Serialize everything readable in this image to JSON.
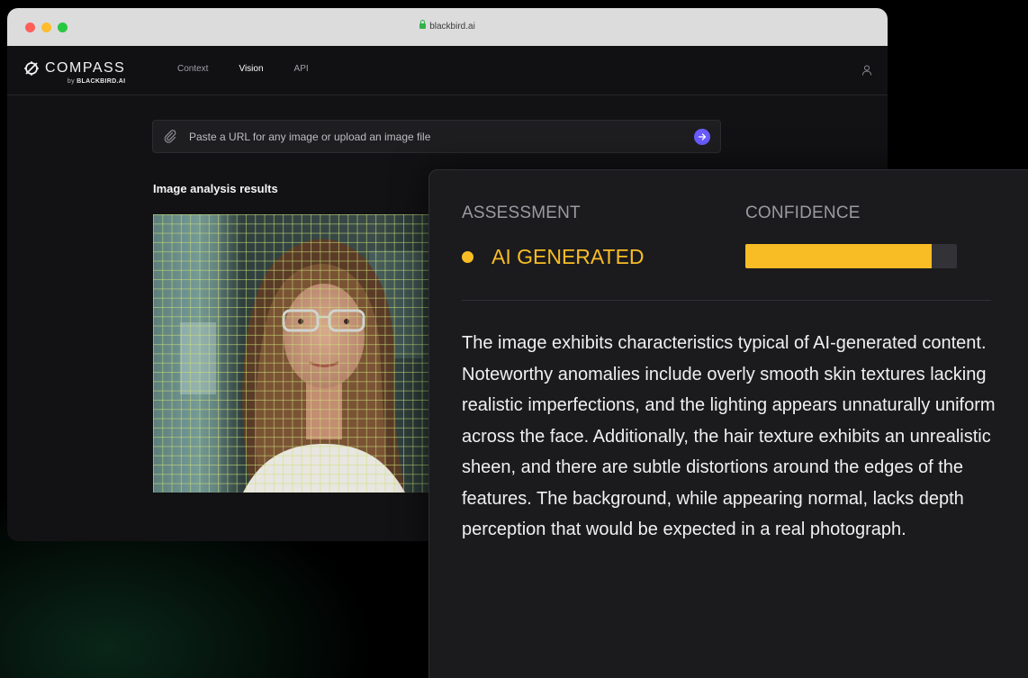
{
  "browser": {
    "url": "blackbird.ai"
  },
  "nav": {
    "logo": "COMPASS",
    "logo_by": "by",
    "logo_brand": "BLACKBIRD.AI",
    "links": [
      {
        "label": "Context"
      },
      {
        "label": "Vision"
      },
      {
        "label": "API"
      }
    ],
    "active": "Vision"
  },
  "search": {
    "placeholder": "Paste a URL for any image or upload an image file"
  },
  "results": {
    "title": "Image analysis results"
  },
  "card": {
    "assessment_label": "ASSESSMENT",
    "confidence_label": "CONFIDENCE",
    "assessment_value": "AI GENERATED",
    "confidence_fraction": 0.88,
    "description": "The image exhibits characteristics typical of AI-generated content. Noteworthy anomalies include overly smooth skin textures lacking realistic imperfections, and the lighting appears unnaturally uniform across the face. Additionally, the hair texture exhibits an unrealistic sheen, and there are subtle distortions around the edges of the features. The background, while appearing normal, lacks depth perception that would be expected in a real photograph."
  },
  "colors": {
    "accent": "#f8bd25",
    "send_button": "#6a5cff",
    "grid": "#cde178"
  },
  "icons": [
    "compass-logo-icon",
    "user-icon",
    "paperclip-icon",
    "arrow-right-icon",
    "lock-icon"
  ]
}
